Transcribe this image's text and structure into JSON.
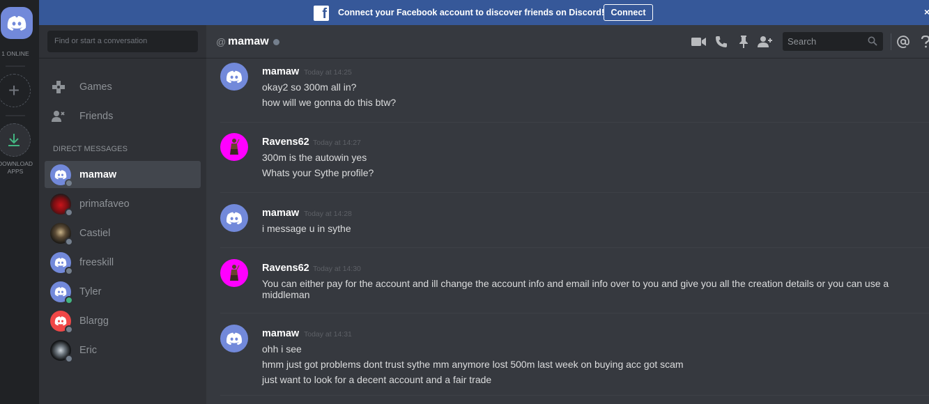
{
  "guild_rail": {
    "online_label": "1 ONLINE",
    "download_label_line1": "DOWNLOAD",
    "download_label_line2": "APPS"
  },
  "banner": {
    "text": "Connect your Facebook account to discover friends on Discord!",
    "button_label": "Connect",
    "close_label": "×",
    "color": "#365899"
  },
  "sidebar": {
    "search_placeholder": "Find or start a conversation",
    "nav": [
      {
        "label": "Games",
        "icon": "gamepad-icon"
      },
      {
        "label": "Friends",
        "icon": "friends-icon"
      }
    ],
    "dm_header": "Direct Messages",
    "dms": [
      {
        "name": "mamaw",
        "avatar": "discord-default-blue",
        "status": "offline",
        "active": true
      },
      {
        "name": "primafaveo",
        "avatar": "photo-red-car",
        "status": "offline",
        "active": false
      },
      {
        "name": "Castiel",
        "avatar": "photo-castiel",
        "status": "offline",
        "active": false
      },
      {
        "name": "freeskill",
        "avatar": "discord-default-blue",
        "status": "offline",
        "active": false
      },
      {
        "name": "Tyler",
        "avatar": "discord-default-blue",
        "status": "online",
        "active": false
      },
      {
        "name": "Blargg",
        "avatar": "discord-default-red",
        "status": "offline",
        "active": false
      },
      {
        "name": "Eric",
        "avatar": "photo-eric",
        "status": "offline",
        "active": false
      }
    ]
  },
  "header": {
    "at_symbol": "@",
    "title": "mamaw",
    "search_placeholder": "Search",
    "icons": [
      "video-call-icon",
      "voice-call-icon",
      "pin-icon",
      "add-friend-icon",
      "mention-icon",
      "help-icon"
    ]
  },
  "messages": [
    {
      "author": "mamaw",
      "time": "Today at 14:25",
      "avatar": "discord-default-blue",
      "lines": [
        "okay2 so 300m all in?",
        "how will we gonna do this btw?"
      ]
    },
    {
      "author": "Ravens62",
      "time": "Today at 14:27",
      "avatar": "magenta-figure",
      "lines": [
        "300m is the autowin yes",
        "Whats your Sythe profile?"
      ]
    },
    {
      "author": "mamaw",
      "time": "Today at 14:28",
      "avatar": "discord-default-blue",
      "lines": [
        "i message u in sythe"
      ]
    },
    {
      "author": "Ravens62",
      "time": "Today at 14:30",
      "avatar": "magenta-figure",
      "lines": [
        "You can either pay for the account and ill change the account info and email info over to you and give you all the creation details or you can use a middleman"
      ]
    },
    {
      "author": "mamaw",
      "time": "Today at 14:31",
      "avatar": "discord-default-blue",
      "lines": [
        "ohh i see",
        "hmm just got problems dont trust sythe mm anymore lost 500m last week on buying acc got scam",
        "just want to look for a decent account and a fair trade"
      ]
    }
  ],
  "colors": {
    "blurple": "#7289da",
    "online_green": "#43b581",
    "offline_grey": "#747f8d",
    "blargg_red": "#f04747",
    "ravens_magenta": "#ff00ff"
  }
}
